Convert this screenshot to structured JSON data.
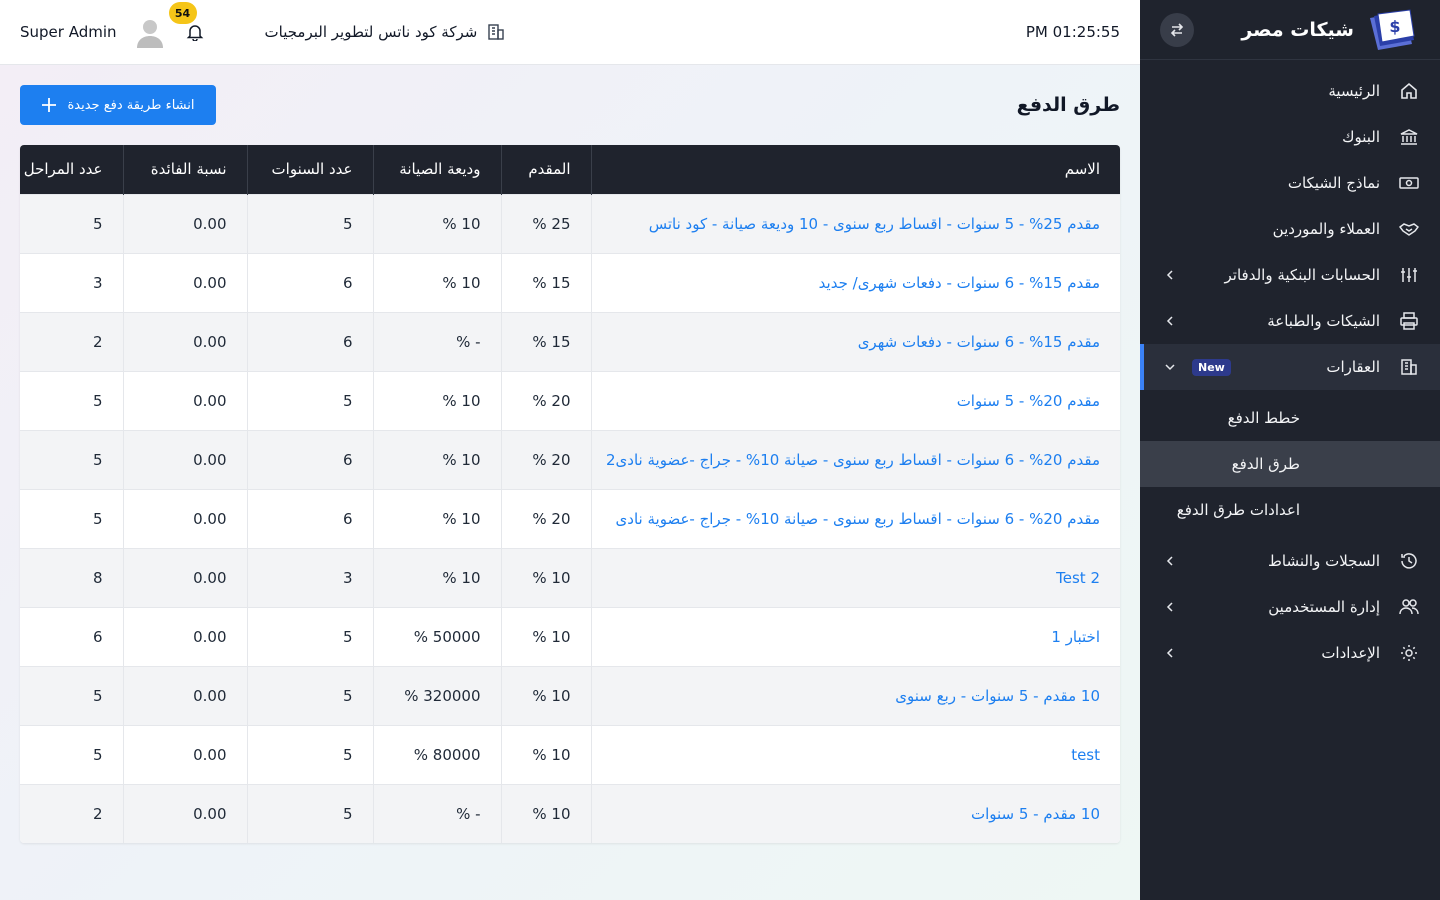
{
  "app": {
    "brand_name": "شيكات مصر"
  },
  "topbar": {
    "clock": "PM 01:25:55",
    "company": "شركة كود ناتس لتطوير البرمجيات",
    "notification_count": "54",
    "user_name": "Super Admin"
  },
  "sidebar": {
    "items": [
      {
        "label": "الرئيسية",
        "icon": "home-icon"
      },
      {
        "label": "البنوك",
        "icon": "bank-icon"
      },
      {
        "label": "نماذج الشيكات",
        "icon": "banknote-icon"
      },
      {
        "label": "العملاء والموردين",
        "icon": "handshake-icon"
      },
      {
        "label": "الحسابات البنكية والدفاتر",
        "icon": "sliders-icon"
      },
      {
        "label": "الشيكات والطباعة",
        "icon": "printer-icon"
      },
      {
        "label": "العقارات",
        "icon": "building-icon",
        "badge": "New"
      }
    ],
    "submenu": [
      {
        "label": "خطط الدفع"
      },
      {
        "label": "طرق الدفع"
      },
      {
        "label": "اعدادات طرق الدفع"
      }
    ],
    "items_after": [
      {
        "label": "السجلات والنشاط",
        "icon": "history-icon"
      },
      {
        "label": "إدارة المستخدمين",
        "icon": "users-icon"
      },
      {
        "label": "الإعدادات",
        "icon": "gear-icon"
      }
    ]
  },
  "page": {
    "title": "طرق الدفع",
    "create_button": "انشاء طريقة دفع جديدة"
  },
  "table": {
    "headers": [
      "الاسم",
      "المقدم",
      "وديعة الصيانة",
      "عدد السنوات",
      "نسبة الفائدة",
      "عدد المراحل"
    ],
    "rows": [
      [
        "مقدم 25% - 5 سنوات - اقساط ربع سنوى - 10 وديعة صيانة - كود ناتس",
        "25 %",
        "10 %",
        "5",
        "0.00",
        "5"
      ],
      [
        "مقدم 15% - 6 سنوات - دفعات شهرى/ جديد",
        "15 %",
        "10 %",
        "6",
        "0.00",
        "3"
      ],
      [
        "مقدم 15% - 6 سنوات - دفعات شهرى",
        "15 %",
        "- %",
        "6",
        "0.00",
        "2"
      ],
      [
        "مقدم 20% - 5 سنوات",
        "20 %",
        "10 %",
        "5",
        "0.00",
        "5"
      ],
      [
        "مقدم 20% - 6 سنوات - اقساط ربع سنوى - صيانة 10% - جراج -عضوية نادى2",
        "20 %",
        "10 %",
        "6",
        "0.00",
        "5"
      ],
      [
        "مقدم 20% - 6 سنوات - اقساط ربع سنوى - صيانة 10% - جراج -عضوية نادى",
        "20 %",
        "10 %",
        "6",
        "0.00",
        "5"
      ],
      [
        "Test 2",
        "10 %",
        "10 %",
        "3",
        "0.00",
        "8"
      ],
      [
        "اختبار 1",
        "10 %",
        "50000 %",
        "5",
        "0.00",
        "6"
      ],
      [
        "10 مقدم - 5 سنوات - ربع سنوى",
        "10 %",
        "320000 %",
        "5",
        "0.00",
        "5"
      ],
      [
        "test",
        "10 %",
        "80000 %",
        "5",
        "0.00",
        "5"
      ],
      [
        "10 مقدم - 5 سنوات",
        "10 %",
        "- %",
        "5",
        "0.00",
        "2"
      ]
    ]
  },
  "colors": {
    "sidebar_bg": "#1f232d",
    "accent_blue": "#1d7ff0",
    "badge_yellow": "#f5c518",
    "active_indicator": "#3b82f6"
  }
}
